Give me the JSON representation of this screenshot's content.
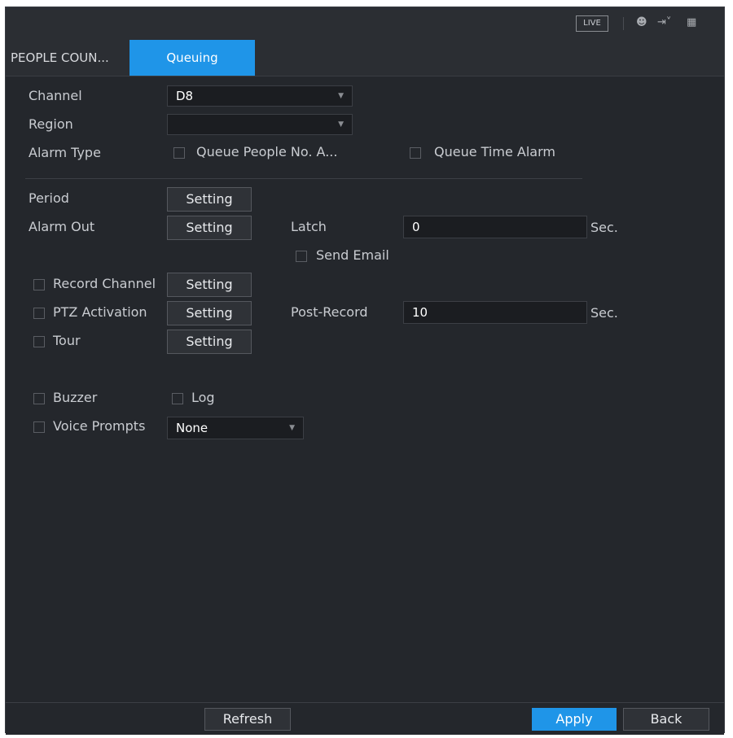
{
  "topbar": {
    "live_label": "LIVE",
    "icons": [
      "user-icon",
      "logout-icon",
      "grid-menu-icon"
    ]
  },
  "tabs": [
    {
      "label": "PEOPLE COUN...",
      "active": false
    },
    {
      "label": "Queuing",
      "active": true
    }
  ],
  "form": {
    "channel": {
      "label": "Channel",
      "value": "D8"
    },
    "region": {
      "label": "Region",
      "value": ""
    },
    "alarm_type": {
      "label": "Alarm Type",
      "option1": "Queue People No. A...",
      "option2": "Queue Time Alarm"
    },
    "period": {
      "label": "Period",
      "button": "Setting"
    },
    "alarm_out": {
      "label": "Alarm Out",
      "button": "Setting"
    },
    "latch": {
      "label": "Latch",
      "value": "0",
      "unit": "Sec."
    },
    "send_email": {
      "label": "Send Email"
    },
    "record_channel": {
      "label": "Record Channel",
      "button": "Setting"
    },
    "ptz_activation": {
      "label": "PTZ Activation",
      "button": "Setting"
    },
    "post_record": {
      "label": "Post-Record",
      "value": "10",
      "unit": "Sec."
    },
    "tour": {
      "label": "Tour",
      "button": "Setting"
    },
    "buzzer": {
      "label": "Buzzer"
    },
    "log": {
      "label": "Log"
    },
    "voice_prompts": {
      "label": "Voice Prompts",
      "value": "None"
    }
  },
  "footer": {
    "refresh": "Refresh",
    "apply": "Apply",
    "back": "Back"
  },
  "colors": {
    "accent": "#1f95e8",
    "background": "#24272c"
  }
}
